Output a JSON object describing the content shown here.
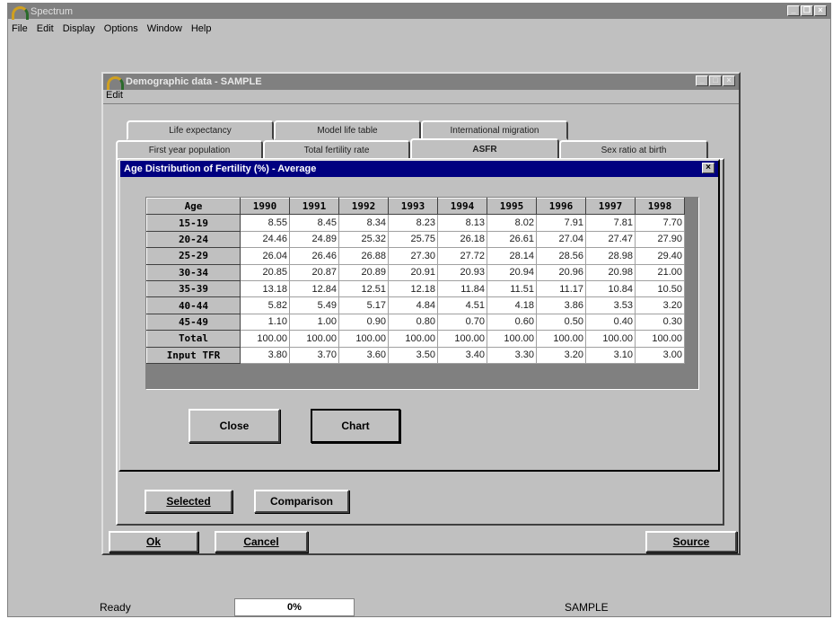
{
  "app": {
    "title": "Spectrum",
    "menu": [
      "File",
      "Edit",
      "Display",
      "Options",
      "Window",
      "Help"
    ]
  },
  "demo_window": {
    "title": "Demographic data - SAMPLE",
    "menu_edit": "Edit",
    "tabs_row1": [
      "Life expectancy",
      "Model life table",
      "International migration"
    ],
    "tabs_row2": [
      "First year population",
      "Total fertility rate",
      "ASFR",
      "Sex ratio at birth"
    ],
    "active_tab": "ASFR",
    "buttons": {
      "selected": "Selected",
      "comparison": "Comparison",
      "ok": "Ok",
      "cancel": "Cancel",
      "source": "Source"
    }
  },
  "dialog": {
    "title": "Age Distribution of Fertility (%) - Average",
    "close_label": "Close",
    "chart_label": "Chart",
    "corner_label": "Age",
    "years": [
      "1990",
      "1991",
      "1992",
      "1993",
      "1994",
      "1995",
      "1996",
      "1997",
      "1998"
    ],
    "rows": [
      {
        "label": "15-19",
        "values": [
          "8.55",
          "8.45",
          "8.34",
          "8.23",
          "8.13",
          "8.02",
          "7.91",
          "7.81",
          "7.70"
        ]
      },
      {
        "label": "20-24",
        "values": [
          "24.46",
          "24.89",
          "25.32",
          "25.75",
          "26.18",
          "26.61",
          "27.04",
          "27.47",
          "27.90"
        ]
      },
      {
        "label": "25-29",
        "values": [
          "26.04",
          "26.46",
          "26.88",
          "27.30",
          "27.72",
          "28.14",
          "28.56",
          "28.98",
          "29.40"
        ]
      },
      {
        "label": "30-34",
        "values": [
          "20.85",
          "20.87",
          "20.89",
          "20.91",
          "20.93",
          "20.94",
          "20.96",
          "20.98",
          "21.00"
        ]
      },
      {
        "label": "35-39",
        "values": [
          "13.18",
          "12.84",
          "12.51",
          "12.18",
          "11.84",
          "11.51",
          "11.17",
          "10.84",
          "10.50"
        ]
      },
      {
        "label": "40-44",
        "values": [
          "5.82",
          "5.49",
          "5.17",
          "4.84",
          "4.51",
          "4.18",
          "3.86",
          "3.53",
          "3.20"
        ]
      },
      {
        "label": "45-49",
        "values": [
          "1.10",
          "1.00",
          "0.90",
          "0.80",
          "0.70",
          "0.60",
          "0.50",
          "0.40",
          "0.30"
        ]
      },
      {
        "label": "Total",
        "values": [
          "100.00",
          "100.00",
          "100.00",
          "100.00",
          "100.00",
          "100.00",
          "100.00",
          "100.00",
          "100.00"
        ]
      },
      {
        "label": "Input TFR",
        "values": [
          "3.80",
          "3.70",
          "3.60",
          "3.50",
          "3.40",
          "3.30",
          "3.20",
          "3.10",
          "3.00"
        ]
      }
    ]
  },
  "status": {
    "ready": "Ready",
    "progress": "0%",
    "progress_fraction": 0,
    "project": "SAMPLE"
  }
}
